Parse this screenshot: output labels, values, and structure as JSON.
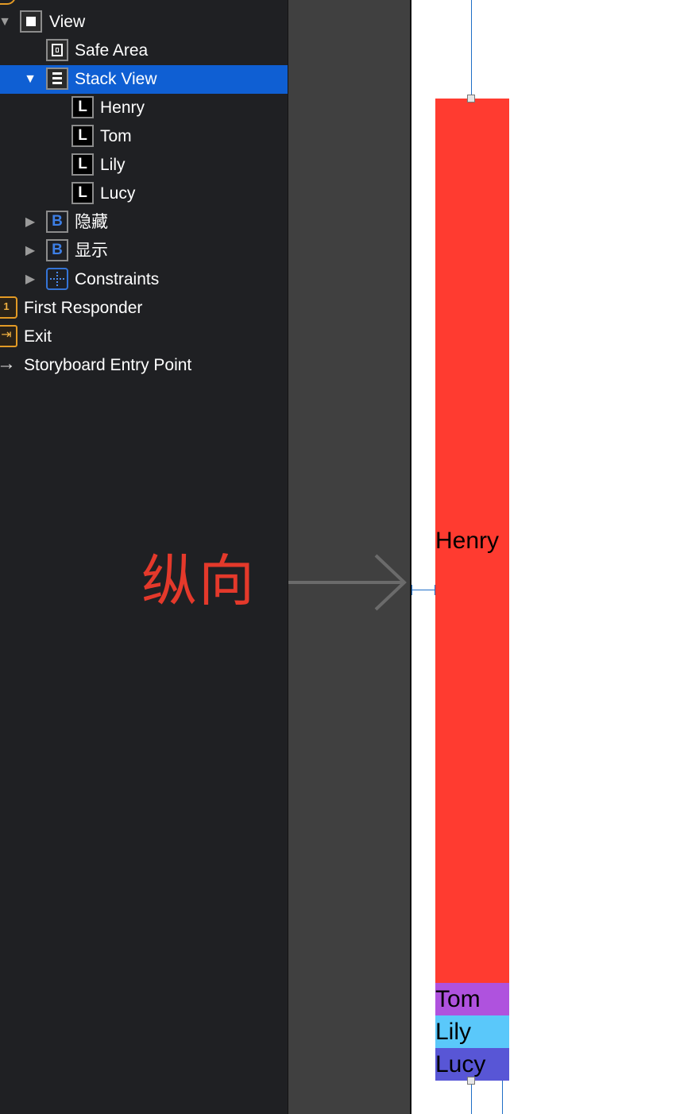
{
  "outline": {
    "items": [
      {
        "label": "View",
        "icon": "view-icon",
        "disclosure": "expanded",
        "selected": false
      },
      {
        "label": "Safe Area",
        "icon": "safe-area-icon",
        "disclosure": "none",
        "selected": false
      },
      {
        "label": "Stack View",
        "icon": "stack-view-icon",
        "disclosure": "expanded",
        "selected": true
      },
      {
        "label": "Henry",
        "icon": "label-icon",
        "icon_glyph": "L",
        "disclosure": "none",
        "selected": false
      },
      {
        "label": "Tom",
        "icon": "label-icon",
        "icon_glyph": "L",
        "disclosure": "none",
        "selected": false
      },
      {
        "label": "Lily",
        "icon": "label-icon",
        "icon_glyph": "L",
        "disclosure": "none",
        "selected": false
      },
      {
        "label": "Lucy",
        "icon": "label-icon",
        "icon_glyph": "L",
        "disclosure": "none",
        "selected": false
      },
      {
        "label": "隐藏",
        "icon": "button-icon",
        "icon_glyph": "B",
        "disclosure": "collapsed",
        "selected": false
      },
      {
        "label": "显示",
        "icon": "button-icon",
        "icon_glyph": "B",
        "disclosure": "collapsed",
        "selected": false
      },
      {
        "label": "Constraints",
        "icon": "constraints-icon",
        "disclosure": "collapsed",
        "selected": false
      },
      {
        "label": "First Responder",
        "icon": "first-responder-icon",
        "icon_glyph": "1",
        "disclosure": "none",
        "selected": false
      },
      {
        "label": "Exit",
        "icon": "exit-icon",
        "icon_glyph": "⇥",
        "disclosure": "none",
        "selected": false
      },
      {
        "label": "Storyboard Entry Point",
        "icon": "entry-point-arrow-icon",
        "icon_glyph": "→",
        "disclosure": "none",
        "selected": false
      }
    ],
    "disclosure_glyphs": {
      "expanded": "▼",
      "collapsed": "▶"
    }
  },
  "annotation": {
    "text": "纵向",
    "color": "#e4392b"
  },
  "stack": {
    "distribution": "vertical",
    "labels": [
      {
        "text": "Henry",
        "color": "#ff3b30"
      },
      {
        "text": "Tom",
        "color": "#af52de"
      },
      {
        "text": "Lily",
        "color": "#5ac8fa"
      },
      {
        "text": "Lucy",
        "color": "#5856d6"
      }
    ]
  },
  "colors": {
    "selection": "#0f5fd3",
    "constraint_line": "#1f6fc7",
    "outline_bg": "#1f2023",
    "canvas_bg": "#404040"
  }
}
